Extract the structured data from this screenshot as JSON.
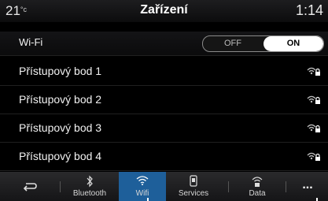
{
  "status": {
    "temperature": "21",
    "temperature_unit": "°c",
    "title": "Zařízení",
    "time": "1:14"
  },
  "wifi": {
    "label": "Wi-Fi",
    "off_label": "OFF",
    "on_label": "ON",
    "state": "ON"
  },
  "access_points": [
    {
      "name": "Přístupový bod 1",
      "icon": "wifi-lock-icon"
    },
    {
      "name": "Přístupový bod 2",
      "icon": "wifi-lock-icon"
    },
    {
      "name": "Přístupový bod 3",
      "icon": "wifi-lock-icon"
    },
    {
      "name": "Přístupový bod 4",
      "icon": "wifi-lock-icon"
    }
  ],
  "nav": {
    "back_icon": "back-arrow-icon",
    "items": [
      {
        "label": "Bluetooth",
        "icon": "bluetooth-icon"
      },
      {
        "label": "Wifi",
        "icon": "wifi-icon",
        "active": true
      },
      {
        "label": "Services",
        "icon": "services-icon"
      },
      {
        "label": "Data",
        "icon": "data-icon"
      }
    ],
    "more_label": "...",
    "active_color": "#1e5f9a"
  }
}
